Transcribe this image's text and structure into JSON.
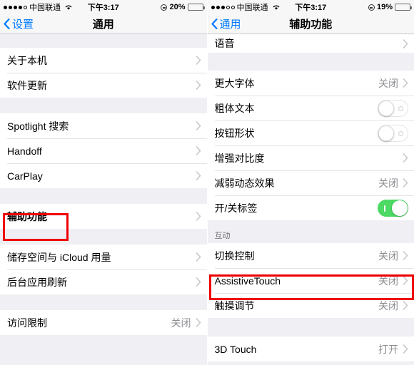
{
  "left": {
    "statusbar": {
      "signal_dots": 4,
      "signal_dots_total": 5,
      "carrier": "中国联通",
      "wifi_icon": "wifi-icon",
      "time": "下午3:17",
      "location_icon": "location-arrow-icon",
      "battery_percent": "20%",
      "battery_level": 20,
      "battery_color": "#fc3d39"
    },
    "nav": {
      "back_label": "设置",
      "back_icon": "chevron-left-icon",
      "title": "通用"
    },
    "groups": [
      {
        "rows": [
          {
            "label": "关于本机",
            "value": "",
            "accessory": "chevron"
          },
          {
            "label": "软件更新",
            "value": "",
            "accessory": "chevron"
          }
        ]
      },
      {
        "rows": [
          {
            "label": "Spotlight 搜索",
            "value": "",
            "accessory": "chevron"
          },
          {
            "label": "Handoff",
            "value": "",
            "accessory": "chevron"
          },
          {
            "label": "CarPlay",
            "value": "",
            "accessory": "chevron"
          }
        ]
      },
      {
        "rows": [
          {
            "label": "辅助功能",
            "value": "",
            "accessory": "chevron",
            "highlighted": true
          }
        ]
      },
      {
        "rows": [
          {
            "label": "储存空间与 iCloud 用量",
            "value": "",
            "accessory": "chevron"
          },
          {
            "label": "后台应用刷新",
            "value": "",
            "accessory": "chevron"
          }
        ]
      },
      {
        "rows": [
          {
            "label": "访问限制",
            "value": "关闭",
            "accessory": "chevron"
          }
        ]
      }
    ]
  },
  "right": {
    "statusbar": {
      "signal_dots": 3,
      "signal_dots_total": 5,
      "carrier": "中国联通",
      "wifi_icon": "wifi-icon",
      "time": "下午3:17",
      "location_icon": "location-arrow-icon",
      "battery_percent": "19%",
      "battery_level": 19,
      "battery_color": "#fc3d39"
    },
    "nav": {
      "back_label": "通用",
      "back_icon": "chevron-left-icon",
      "title": "辅助功能"
    },
    "section_header_interaction": "互动",
    "groups": [
      {
        "rows": [
          {
            "label": "语音",
            "value": "",
            "accessory": "chevron"
          }
        ]
      },
      {
        "rows": [
          {
            "label": "更大字体",
            "value": "关闭",
            "accessory": "chevron"
          },
          {
            "label": "粗体文本",
            "value": "",
            "accessory": "switch",
            "switch_on": false
          },
          {
            "label": "按钮形状",
            "value": "",
            "accessory": "switch",
            "switch_on": false
          },
          {
            "label": "增强对比度",
            "value": "",
            "accessory": "chevron"
          },
          {
            "label": "减弱动态效果",
            "value": "关闭",
            "accessory": "chevron"
          },
          {
            "label": "开/关标签",
            "value": "",
            "accessory": "switch",
            "switch_on": true
          }
        ]
      },
      {
        "header": "互动",
        "rows": [
          {
            "label": "切换控制",
            "value": "关闭",
            "accessory": "chevron"
          },
          {
            "label": "AssistiveTouch",
            "value": "关闭",
            "accessory": "chevron",
            "highlighted": true
          },
          {
            "label": "触摸调节",
            "value": "关闭",
            "accessory": "chevron"
          }
        ]
      },
      {
        "rows": [
          {
            "label": "3D Touch",
            "value": "打开",
            "accessory": "chevron"
          }
        ]
      }
    ]
  },
  "colors": {
    "accent_blue": "#007aff",
    "switch_on_green": "#4cd964",
    "highlight_red": "#ef0000",
    "group_bg": "#efeff4",
    "value_gray": "#8e8e93"
  }
}
